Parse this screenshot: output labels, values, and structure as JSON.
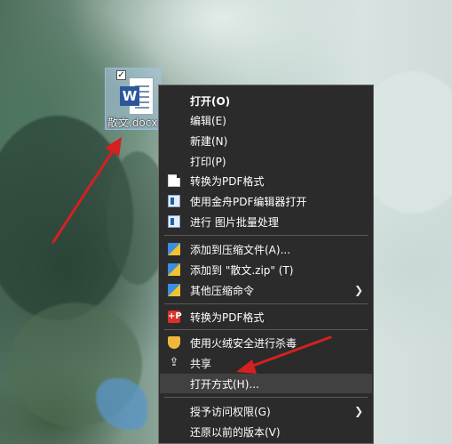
{
  "desktop_icon": {
    "label": "散文.docx",
    "icon": "word-document-icon",
    "selected": true
  },
  "context_menu": {
    "items": [
      {
        "label": "打开(O)",
        "icon": "",
        "bold": true
      },
      {
        "label": "编辑(E)",
        "icon": ""
      },
      {
        "label": "新建(N)",
        "icon": ""
      },
      {
        "label": "打印(P)",
        "icon": ""
      },
      {
        "label": "转换为PDF格式",
        "icon": "blank-document-icon"
      },
      {
        "label": "使用金舟PDF编辑器打开",
        "icon": "pdf-editor-icon"
      },
      {
        "label": "进行 图片批量处理",
        "icon": "image-batch-icon"
      },
      {
        "label": "添加到压缩文件(A)...",
        "icon": "archive-icon"
      },
      {
        "label": "添加到 \"散文.zip\" (T)",
        "icon": "archive-icon"
      },
      {
        "label": "其他压缩命令",
        "icon": "archive-icon",
        "submenu": true
      },
      {
        "label": "转换为PDF格式",
        "icon": "pdf-convert-icon"
      },
      {
        "label": "使用火绒安全进行杀毒",
        "icon": "huorong-shield-icon"
      },
      {
        "label": "共享",
        "icon": "share-icon"
      },
      {
        "label": "打开方式(H)...",
        "icon": "",
        "highlighted": true
      },
      {
        "label": "授予访问权限(G)",
        "icon": "",
        "submenu": true
      },
      {
        "label": "还原以前的版本(V)",
        "icon": ""
      }
    ]
  },
  "annotation_color": "#d42020"
}
